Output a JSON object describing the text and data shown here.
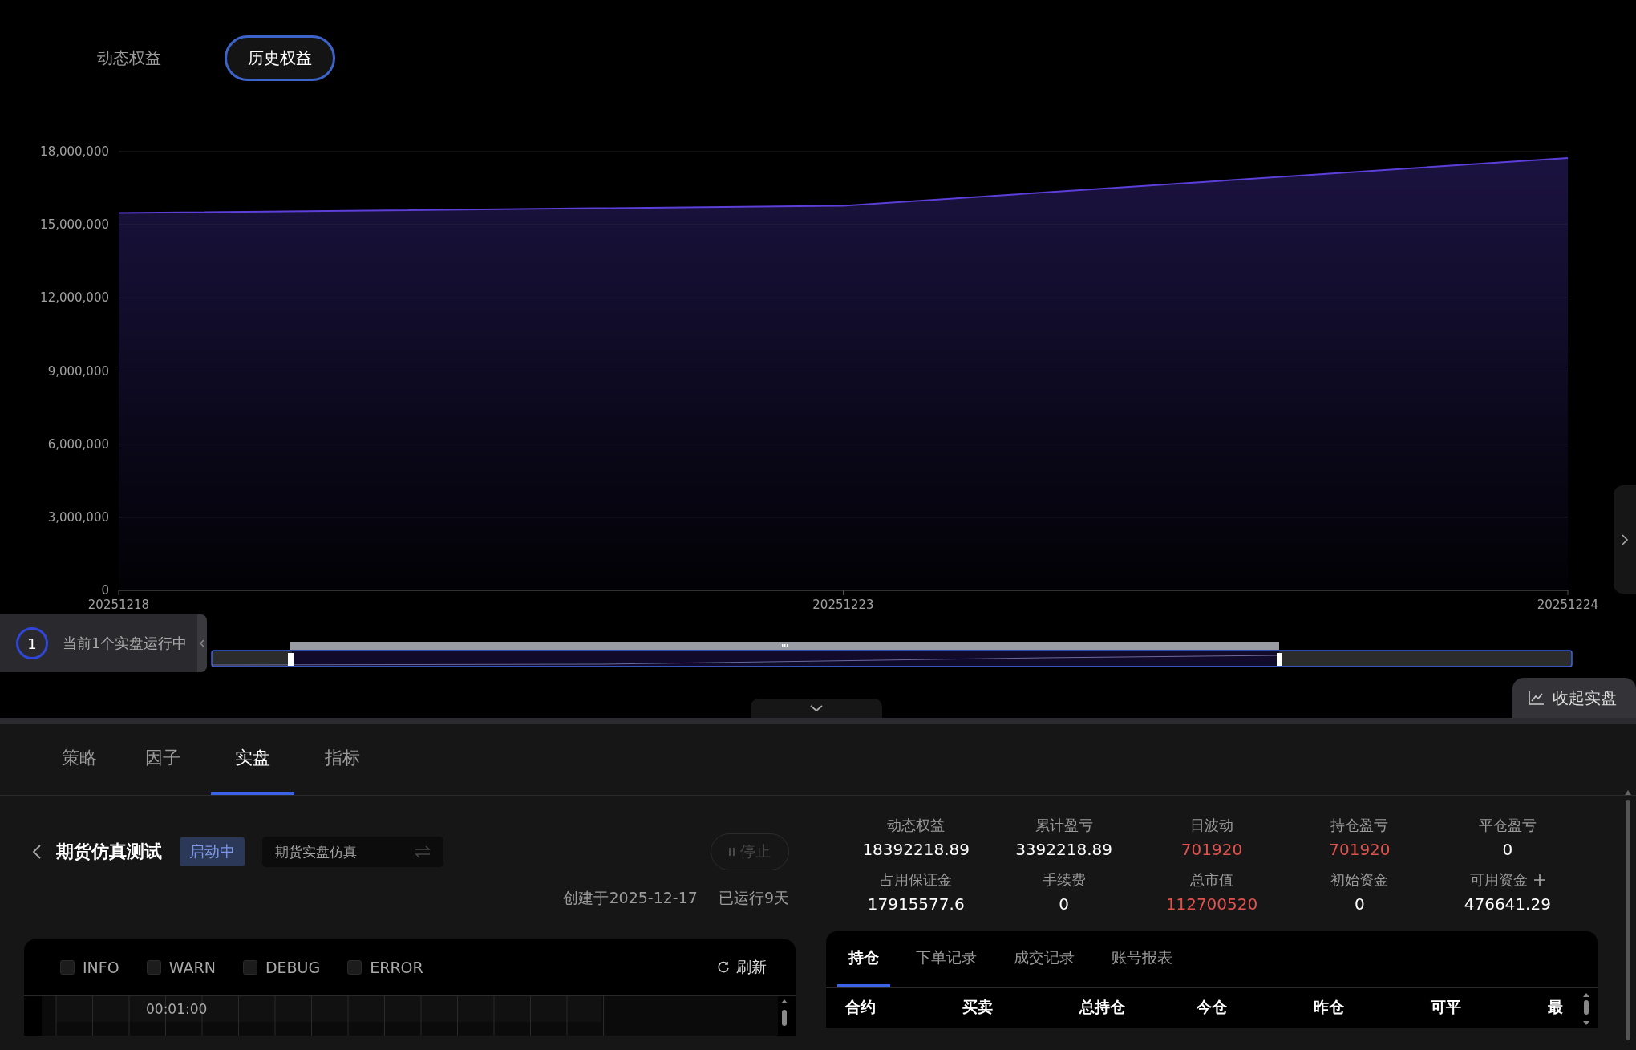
{
  "view_tabs": [
    {
      "label": "动态权益",
      "selected": false
    },
    {
      "label": "历史权益",
      "selected": true
    }
  ],
  "chart": {
    "chart_data": {
      "type": "area",
      "categories": [
        "20251218",
        "20251223",
        "20251224"
      ],
      "series": [
        {
          "color": "#5b3fd8",
          "values": [
            15480000,
            15780000,
            17740000
          ]
        }
      ],
      "ylim": [
        0,
        18000000
      ],
      "grid": true,
      "yticks": [
        {
          "value": 0,
          "label": "0"
        },
        {
          "value": 3000000,
          "label": "3,000,000"
        },
        {
          "value": 6000000,
          "label": "6,000,000"
        },
        {
          "value": 9000000,
          "label": "9,000,000"
        },
        {
          "value": 12000000,
          "label": "12,000,000"
        },
        {
          "value": 15000000,
          "label": "15,000,000"
        },
        {
          "value": 18000000,
          "label": "18,000,000"
        }
      ]
    }
  },
  "running": {
    "count": "1",
    "text": "当前1个实盘运行中"
  },
  "collapse_button": "收起实盘",
  "main_tabs": [
    {
      "label": "策略",
      "selected": false
    },
    {
      "label": "因子",
      "selected": false
    },
    {
      "label": "实盘",
      "selected": true
    },
    {
      "label": "指标",
      "selected": false
    }
  ],
  "account": {
    "title": "期货仿真测试",
    "status": "启动中",
    "mode": "期货实盘仿真",
    "stop_button": "停止",
    "created": "创建于2025-12-17",
    "running_days": "已运行9天"
  },
  "log_panel": {
    "levels": [
      {
        "label": "INFO",
        "checked": false
      },
      {
        "label": "WARN",
        "checked": false
      },
      {
        "label": "DEBUG",
        "checked": false
      },
      {
        "label": "ERROR",
        "checked": false
      }
    ],
    "refresh": "刷新",
    "time": "00:01:00"
  },
  "metrics": [
    {
      "label": "动态权益",
      "value": "18392218.89",
      "color": "#ffffff"
    },
    {
      "label": "累计盈亏",
      "value": "3392218.89",
      "color": "#ffffff"
    },
    {
      "label": "日波动",
      "value": "701920",
      "color": "#e0524e"
    },
    {
      "label": "持仓盈亏",
      "value": "701920",
      "color": "#e0524e"
    },
    {
      "label": "平仓盈亏",
      "value": "0",
      "color": "#ffffff"
    },
    {
      "label": "占用保证金",
      "value": "17915577.6",
      "color": "#ffffff"
    },
    {
      "label": "手续费",
      "value": "0",
      "color": "#ffffff"
    },
    {
      "label": "总市值",
      "value": "112700520",
      "color": "#e0524e"
    },
    {
      "label": "初始资金",
      "value": "0",
      "color": "#ffffff"
    },
    {
      "label": "可用资金",
      "value": "476641.29",
      "color": "#ffffff",
      "kind": "addable"
    }
  ],
  "table": {
    "tabs": [
      {
        "label": "持仓",
        "selected": true
      },
      {
        "label": "下单记录",
        "selected": false
      },
      {
        "label": "成交记录",
        "selected": false
      },
      {
        "label": "账号报表",
        "selected": false
      }
    ],
    "columns": [
      "合约",
      "买卖",
      "总持仓",
      "今仓",
      "昨仓",
      "可平",
      "最"
    ]
  }
}
